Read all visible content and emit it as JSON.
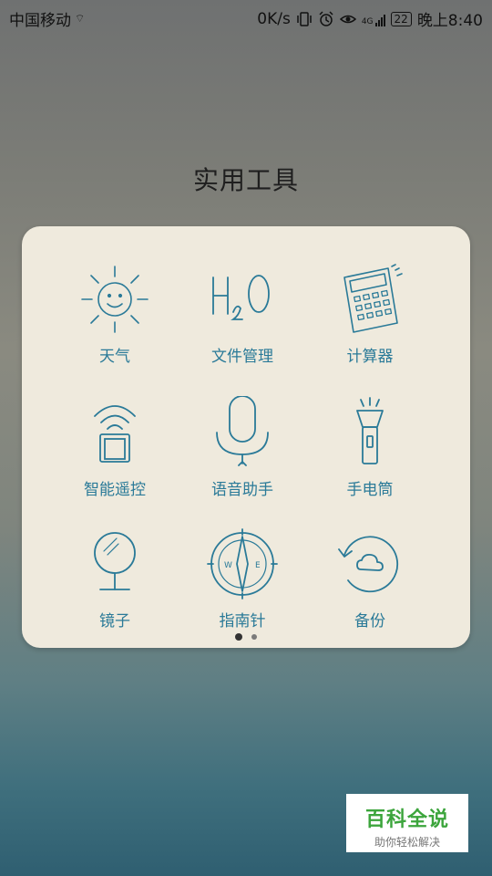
{
  "status_bar": {
    "carrier": "中国移动",
    "net_speed": "0K/s",
    "network": "4G",
    "battery": "22",
    "time": "晚上8:40"
  },
  "folder": {
    "title": "实用工具",
    "apps": [
      {
        "label": "天气",
        "icon": "sun-icon"
      },
      {
        "label": "文件管理",
        "icon": "h2o-icon"
      },
      {
        "label": "计算器",
        "icon": "calculator-icon"
      },
      {
        "label": "智能遥控",
        "icon": "remote-control-icon"
      },
      {
        "label": "语音助手",
        "icon": "microphone-icon"
      },
      {
        "label": "手电筒",
        "icon": "flashlight-icon"
      },
      {
        "label": "镜子",
        "icon": "mirror-icon"
      },
      {
        "label": "指南针",
        "icon": "compass-icon"
      },
      {
        "label": "备份",
        "icon": "backup-icon"
      }
    ]
  },
  "watermark": {
    "title": "百科全说",
    "subtitle": "助你轻松解决"
  },
  "colors": {
    "icon_stroke": "#2a7a98",
    "panel_bg": "#efeadd"
  }
}
